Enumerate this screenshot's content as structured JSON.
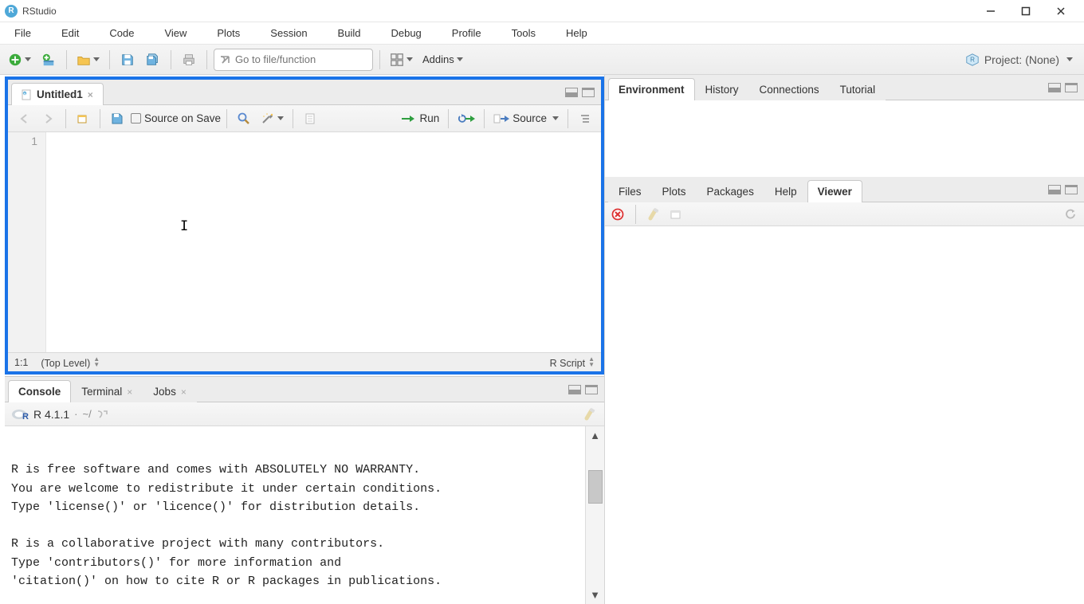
{
  "app": {
    "title": "RStudio"
  },
  "menubar": [
    "File",
    "Edit",
    "Code",
    "View",
    "Plots",
    "Session",
    "Build",
    "Debug",
    "Profile",
    "Tools",
    "Help"
  ],
  "toolbar": {
    "goto_placeholder": "Go to file/function",
    "addins_label": "Addins",
    "project_label": "Project: (None)"
  },
  "source": {
    "tab_label": "Untitled1",
    "source_on_save": "Source on Save",
    "run_label": "Run",
    "source_label": "Source",
    "line_number": "1",
    "status_pos": "1:1",
    "status_scope": "(Top Level)",
    "status_type": "R Script"
  },
  "console": {
    "tabs": [
      "Console",
      "Terminal",
      "Jobs"
    ],
    "version": "R 4.1.1",
    "path_sep": " · ",
    "path": "~/",
    "body": "\nR is free software and comes with ABSOLUTELY NO WARRANTY.\nYou are welcome to redistribute it under certain conditions.\nType 'license()' or 'licence()' for distribution details.\n\nR is a collaborative project with many contributors.\nType 'contributors()' for more information and\n'citation()' on how to cite R or R packages in publications."
  },
  "right_top_tabs": [
    "Environment",
    "History",
    "Connections",
    "Tutorial"
  ],
  "right_bottom_tabs": [
    "Files",
    "Plots",
    "Packages",
    "Help",
    "Viewer"
  ]
}
